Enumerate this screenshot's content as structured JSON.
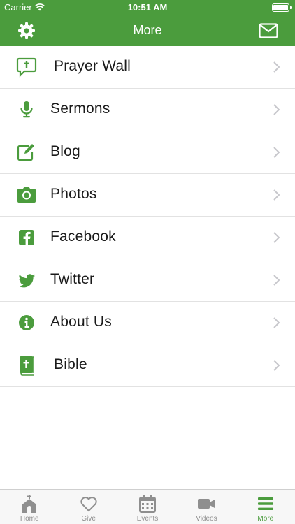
{
  "status": {
    "carrier": "Carrier",
    "time": "10:51 AM"
  },
  "header": {
    "title": "More"
  },
  "menu": [
    {
      "label": "Prayer Wall",
      "icon": "prayer-wall-icon"
    },
    {
      "label": "Sermons",
      "icon": "microphone-icon"
    },
    {
      "label": "Blog",
      "icon": "edit-icon"
    },
    {
      "label": "Photos",
      "icon": "camera-icon"
    },
    {
      "label": "Facebook",
      "icon": "facebook-icon"
    },
    {
      "label": "Twitter",
      "icon": "twitter-icon"
    },
    {
      "label": "About Us",
      "icon": "info-icon"
    },
    {
      "label": "Bible",
      "icon": "bible-icon"
    }
  ],
  "tabs": [
    {
      "label": "Home",
      "icon": "church-icon"
    },
    {
      "label": "Give",
      "icon": "heart-icon"
    },
    {
      "label": "Events",
      "icon": "calendar-icon"
    },
    {
      "label": "Videos",
      "icon": "video-camera-icon"
    },
    {
      "label": "More",
      "icon": "menu-icon",
      "active": true
    }
  ],
  "colors": {
    "accent": "#4b9c3d",
    "tab_inactive": "#8f8f8f",
    "divider": "#e2e2e2"
  }
}
